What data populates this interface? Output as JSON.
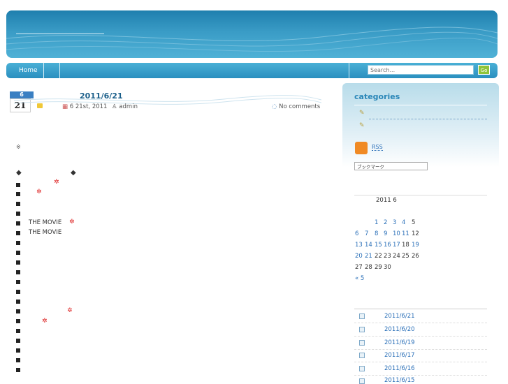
{
  "nav": {
    "home": "Home",
    "search_placeholder": "Search...",
    "go": "Go"
  },
  "post": {
    "month": "6",
    "day": "21",
    "title": "2011/6/21",
    "date_meta": "6 21st, 2011",
    "author": "admin",
    "comments": "No comments",
    "lines": [
      "THE MOVIE",
      "THE MOVIE"
    ]
  },
  "sidebar": {
    "categories_title": "categories",
    "rss": "RSS",
    "bookmark": "ブックマーク",
    "calendar": {
      "caption": "2011 6",
      "rows": [
        [
          "1",
          "2",
          "3",
          "4",
          "5"
        ],
        [
          "6",
          "7",
          "8",
          "9",
          "10",
          "11",
          "12"
        ],
        [
          "13",
          "14",
          "15",
          "16",
          "17",
          "18",
          "19"
        ],
        [
          "20",
          "21",
          "22",
          "23",
          "24",
          "25",
          "26"
        ],
        [
          "27",
          "28",
          "29",
          "30"
        ]
      ],
      "prev": "« 5"
    },
    "recent_posts": [
      "2011/6/21",
      "2011/6/20",
      "2011/6/19",
      "2011/6/17",
      "2011/6/16",
      "2011/6/15"
    ]
  },
  "colors": {
    "accent": "#2a87b8",
    "link": "#2a6fb8",
    "header": "#3a9cc6"
  }
}
